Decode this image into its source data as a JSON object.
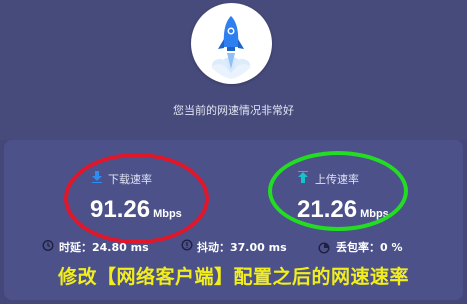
{
  "status": {
    "text": "您当前的网速情况非常好"
  },
  "download": {
    "label": "下载速率",
    "value": "91.26",
    "unit": "Mbps",
    "icon": "download-arrow-icon"
  },
  "upload": {
    "label": "上传速率",
    "value": "21.26",
    "unit": "Mbps",
    "icon": "upload-arrow-icon"
  },
  "stats": {
    "latency": {
      "label": "时延：24.80 ms",
      "icon": "timer-icon"
    },
    "jitter": {
      "label": "抖动：37.00 ms",
      "icon": "jitter-icon"
    },
    "loss": {
      "label": "丢包率：0 %",
      "icon": "pie-chart-icon"
    }
  },
  "caption": {
    "text": "修改【网络客户端】配置之后的网速速率"
  },
  "colors": {
    "background": "#43477a",
    "panel": "#4c5289",
    "download_arrow": "#2f8cf0",
    "upload_arrow": "#19c0c9",
    "red_ring": "#e0162b",
    "green_ring": "#22dd22",
    "caption": "#f2ee1c",
    "rocket": "#2e7ff0"
  }
}
